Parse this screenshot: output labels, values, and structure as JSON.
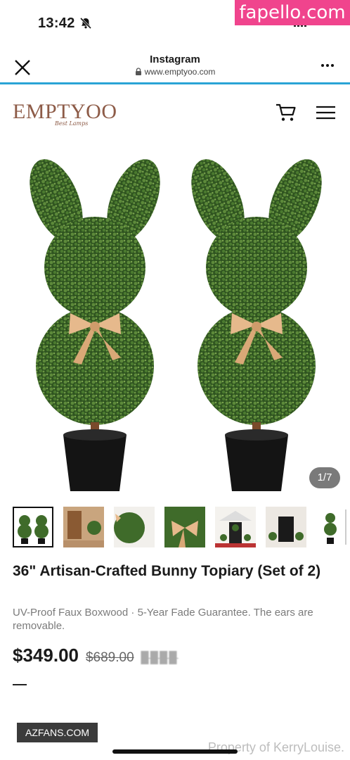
{
  "status_bar": {
    "time": "13:42",
    "watermark": "fapello.com"
  },
  "browser": {
    "title": "Instagram",
    "url": "www.emptyoo.com"
  },
  "site": {
    "logo": "EMPTYOO",
    "logo_tagline": "Best Lamps"
  },
  "gallery": {
    "counter": "1/7",
    "thumbnail_count": 7,
    "active_index": 0
  },
  "product": {
    "title": "36\" Artisan-Crafted Bunny Topiary (Set of 2)",
    "subtitle": "UV-Proof Faux Boxwood · 5-Year Fade Guarantee. The ears are removable.",
    "price": "$349.00",
    "price_was": "$689.00",
    "price_extra": "▉▉▉▉"
  },
  "overlays": {
    "badge": "AZFANS.COM",
    "credit": "Property of KerryLouise."
  },
  "colors": {
    "accent_line": "#2aa4d6",
    "logo": "#8d5b47",
    "watermark_bg": "#f0448d",
    "foliage": "#3f6b2a",
    "ribbon": "#e6b98c",
    "pot": "#141414"
  },
  "icons": [
    "bell-slash-icon",
    "close-icon",
    "lock-icon",
    "more-icon",
    "cart-icon",
    "menu-icon"
  ]
}
